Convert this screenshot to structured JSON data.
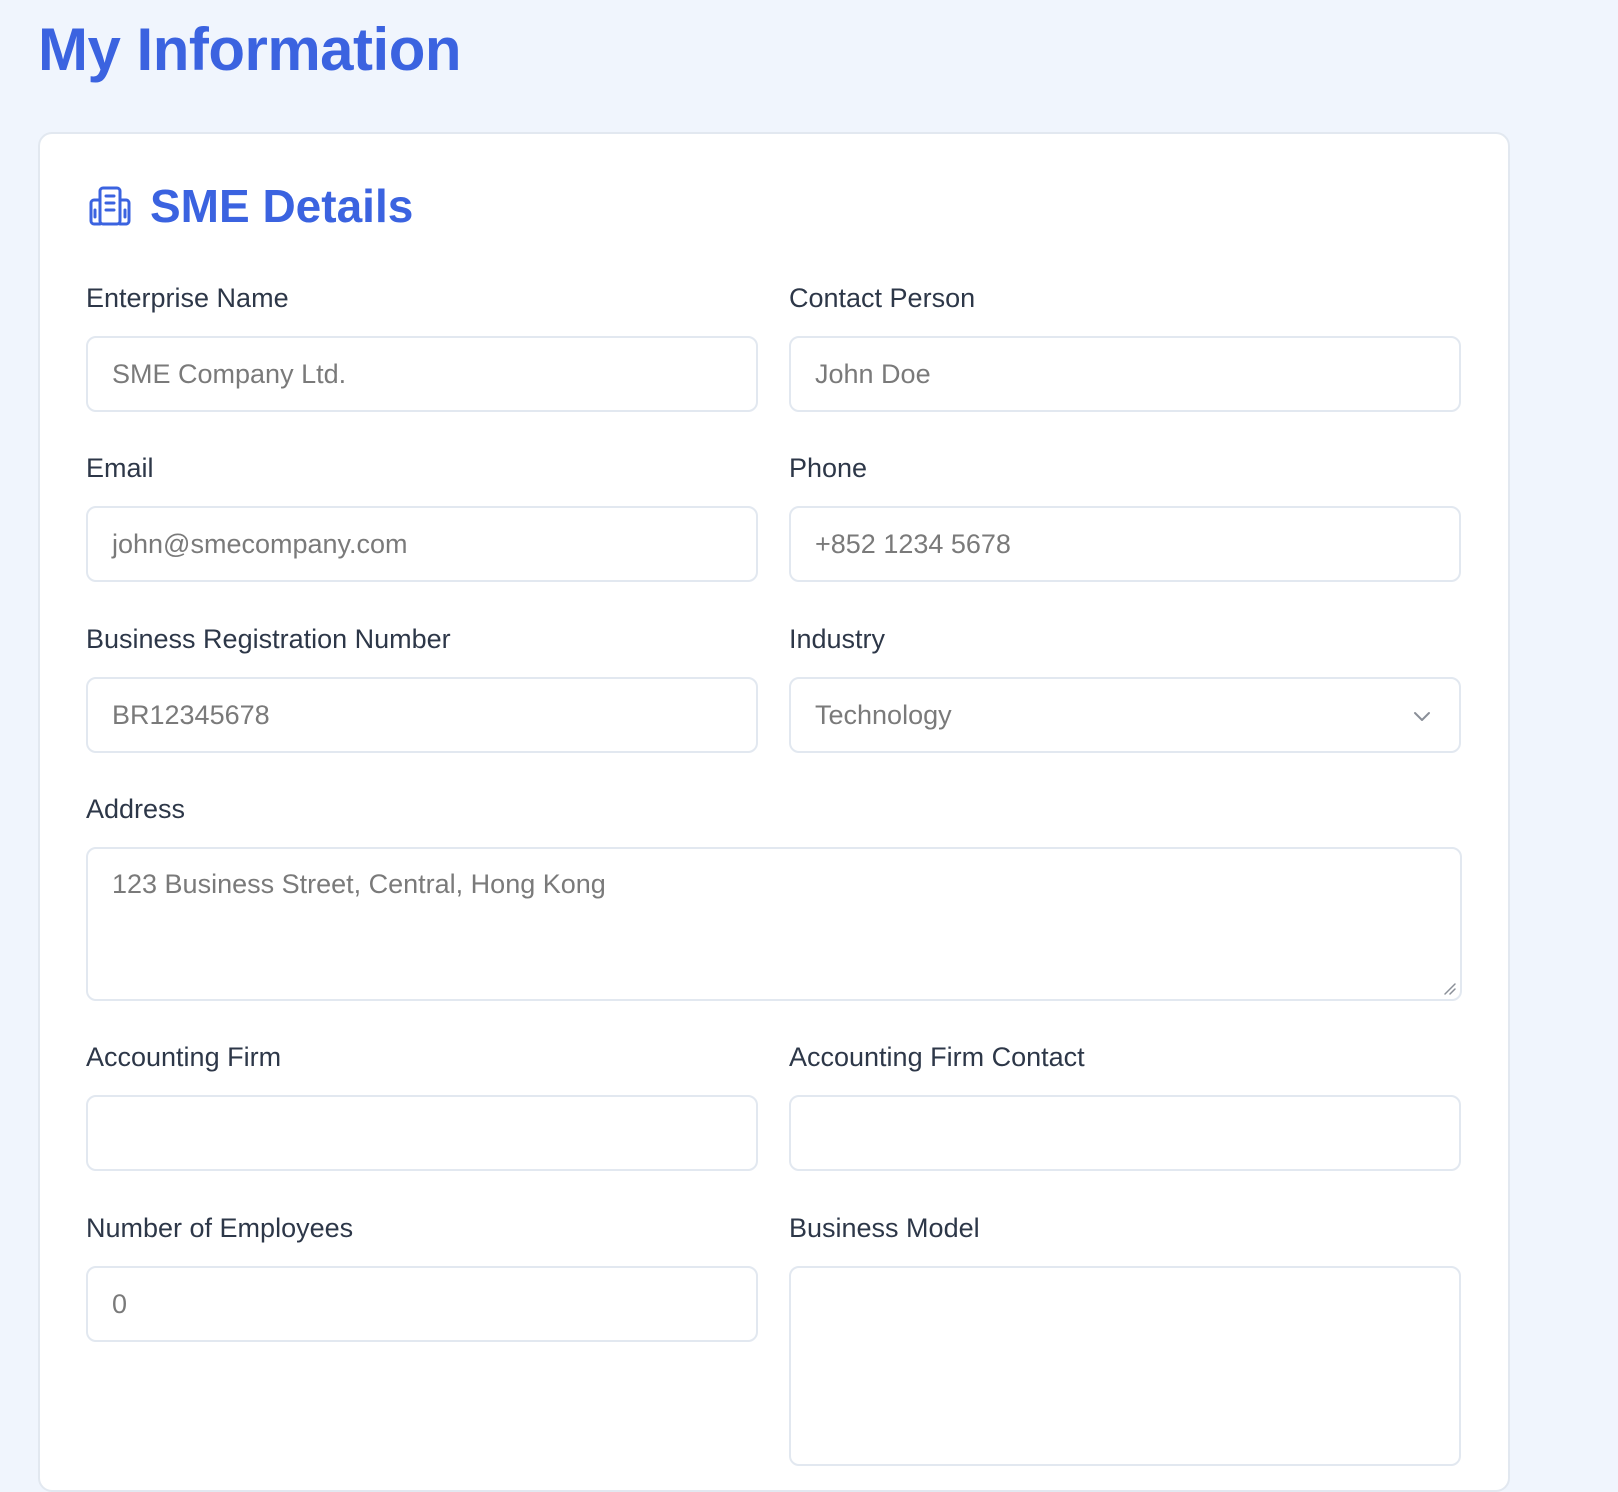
{
  "page": {
    "title": "My Information"
  },
  "section": {
    "title": "SME Details",
    "icon": "building-icon"
  },
  "fields": {
    "enterprise_name": {
      "label": "Enterprise Name",
      "placeholder": "SME Company Ltd."
    },
    "contact_person": {
      "label": "Contact Person",
      "placeholder": "John Doe"
    },
    "email": {
      "label": "Email",
      "placeholder": "john@smecompany.com"
    },
    "phone": {
      "label": "Phone",
      "placeholder": "+852 1234 5678"
    },
    "br_number": {
      "label": "Business Registration Number",
      "placeholder": "BR12345678"
    },
    "industry": {
      "label": "Industry",
      "value": "Technology"
    },
    "address": {
      "label": "Address",
      "placeholder": "123 Business Street, Central, Hong Kong"
    },
    "accounting_firm": {
      "label": "Accounting Firm",
      "value": ""
    },
    "accounting_firm_contact": {
      "label": "Accounting Firm Contact",
      "value": ""
    },
    "employees": {
      "label": "Number of Employees",
      "placeholder": "0"
    },
    "business_model": {
      "label": "Business Model",
      "value": ""
    }
  },
  "colors": {
    "accent": "#3b63e0",
    "background": "#f0f5fd",
    "border": "#e2e8f0",
    "placeholder": "#7a7a7a",
    "label": "#2d3748"
  }
}
